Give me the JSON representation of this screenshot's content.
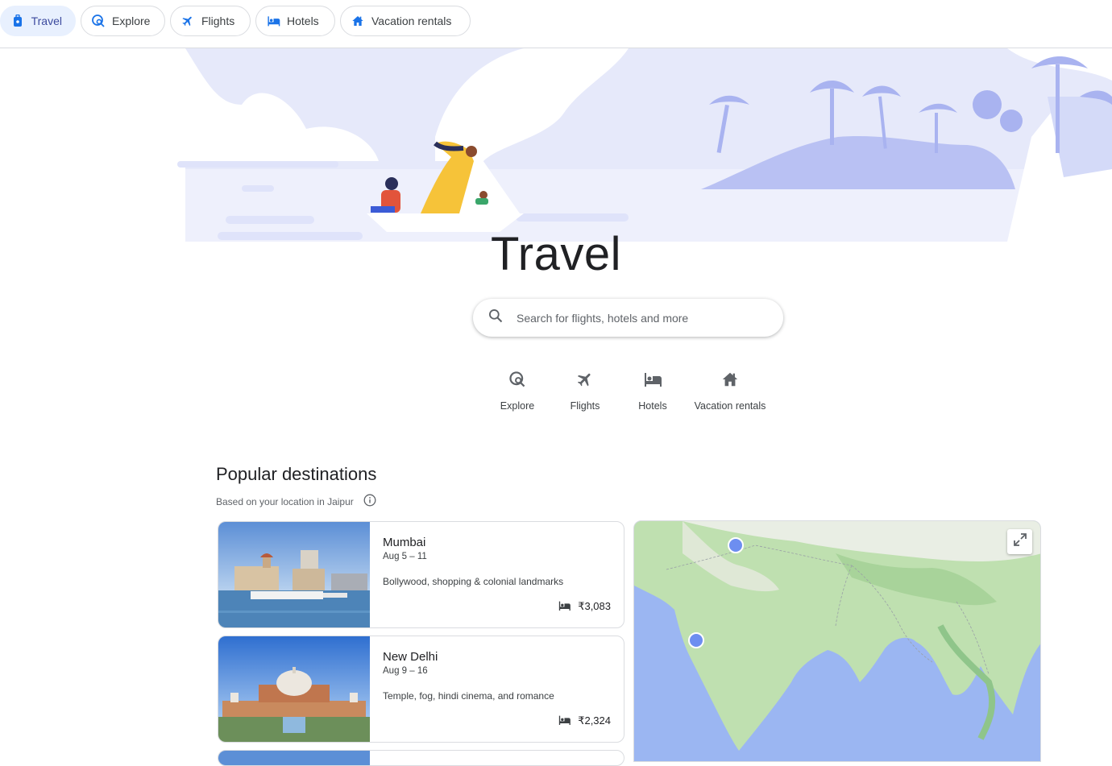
{
  "nav": {
    "tabs": [
      {
        "label": "Travel",
        "icon": "travel-bag-icon",
        "active": true
      },
      {
        "label": "Explore",
        "icon": "explore-icon",
        "active": false
      },
      {
        "label": "Flights",
        "icon": "plane-icon",
        "active": false
      },
      {
        "label": "Hotels",
        "icon": "bed-icon",
        "active": false
      },
      {
        "label": "Vacation rentals",
        "icon": "house-icon",
        "active": false
      }
    ]
  },
  "hero": {
    "title": "Travel"
  },
  "search": {
    "placeholder": "Search for flights, hotels and more"
  },
  "quick_links": [
    {
      "label": "Explore",
      "icon": "explore-icon"
    },
    {
      "label": "Flights",
      "icon": "plane-icon"
    },
    {
      "label": "Hotels",
      "icon": "bed-icon"
    },
    {
      "label": "Vacation rentals",
      "icon": "house-icon"
    }
  ],
  "popular": {
    "title": "Popular destinations",
    "subtitle": "Based on your location in Jaipur",
    "destinations": [
      {
        "city": "Mumbai",
        "dates": "Aug 5 – 11",
        "description": "Bollywood, shopping & colonial landmarks",
        "price": "₹3,083"
      },
      {
        "city": "New Delhi",
        "dates": "Aug 9 – 16",
        "description": "Temple, fog, hindi cinema, and romance",
        "price": "₹2,324"
      }
    ]
  },
  "colors": {
    "accent": "#1a73e8",
    "active_chip_bg": "#e8f0fe",
    "hero_lavender": "#d2d8f7",
    "map_water": "#9bb6f2",
    "map_land": "#bfe0b0",
    "marker": "#6d8ef0"
  }
}
